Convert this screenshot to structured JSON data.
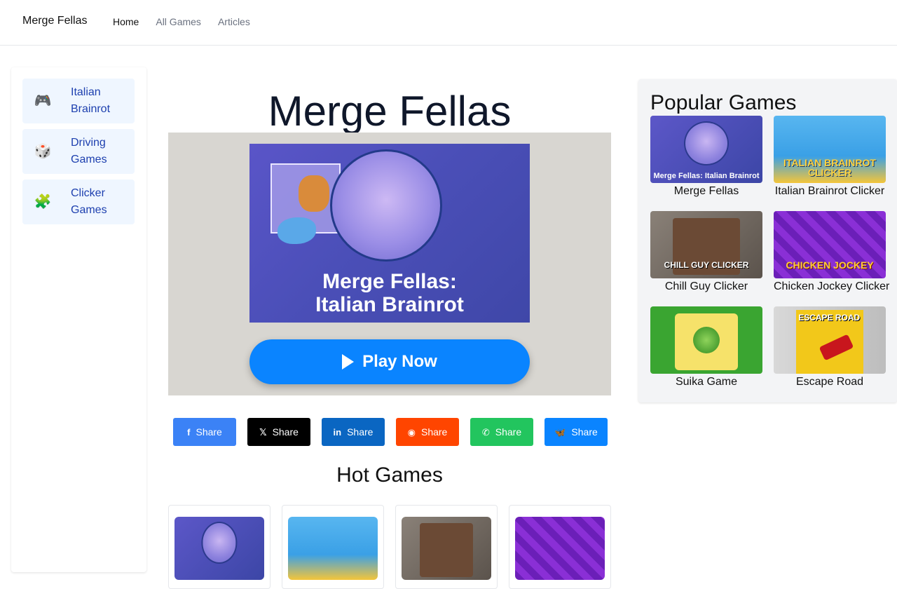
{
  "header": {
    "brand": "Merge Fellas",
    "nav": [
      {
        "label": "Home"
      },
      {
        "label": "All Games"
      },
      {
        "label": "Articles"
      }
    ]
  },
  "sidebar": {
    "categories": [
      {
        "emoji": "🎮",
        "label": "Italian Brainrot"
      },
      {
        "emoji": "🎲",
        "label": "Driving Games"
      },
      {
        "emoji": "🧩",
        "label": "Clicker Games"
      }
    ]
  },
  "main": {
    "title": "Merge Fellas",
    "cover_text": {
      "line1": "Merge Fellas:",
      "line2": "Italian Brainrot"
    },
    "play_button": "Play Now",
    "shares": [
      {
        "network": "facebook",
        "icon": "f",
        "label": "Share",
        "color": "#3b82f6"
      },
      {
        "network": "x",
        "icon": "𝕏",
        "label": "Share",
        "color": "#000000"
      },
      {
        "network": "linkedin",
        "icon": "in",
        "label": "Share",
        "color": "#0a66c2"
      },
      {
        "network": "reddit",
        "icon": "◉",
        "label": "Share",
        "color": "#ff4500"
      },
      {
        "network": "whatsapp",
        "icon": "✆",
        "label": "Share",
        "color": "#22c55e"
      },
      {
        "network": "bluesky",
        "icon": "🦋",
        "label": "Share",
        "color": "#0a84ff"
      }
    ],
    "hot_title": "Hot Games"
  },
  "popular": {
    "title": "Popular Games",
    "games": [
      {
        "name": "Merge Fellas",
        "thumb_text": "Merge Fellas: Italian Brainrot"
      },
      {
        "name": "Italian Brainrot Clicker",
        "thumb_text": "ITALIAN BRAINROT CLICKER"
      },
      {
        "name": "Chill Guy Clicker",
        "thumb_text": "CHILL GUY CLICKER"
      },
      {
        "name": "Chicken Jockey Clicker",
        "thumb_text": "CHICKEN JOCKEY"
      },
      {
        "name": "Suika Game",
        "thumb_text": "Suika Game"
      },
      {
        "name": "Escape Road",
        "thumb_text": "ESCAPE ROAD"
      }
    ]
  },
  "colors": {
    "accent": "#0a84ff",
    "category_bg": "#eff6ff",
    "category_text": "#1e40af",
    "player_bg": "#d8d6d1",
    "panel_bg": "#f3f4f6"
  }
}
